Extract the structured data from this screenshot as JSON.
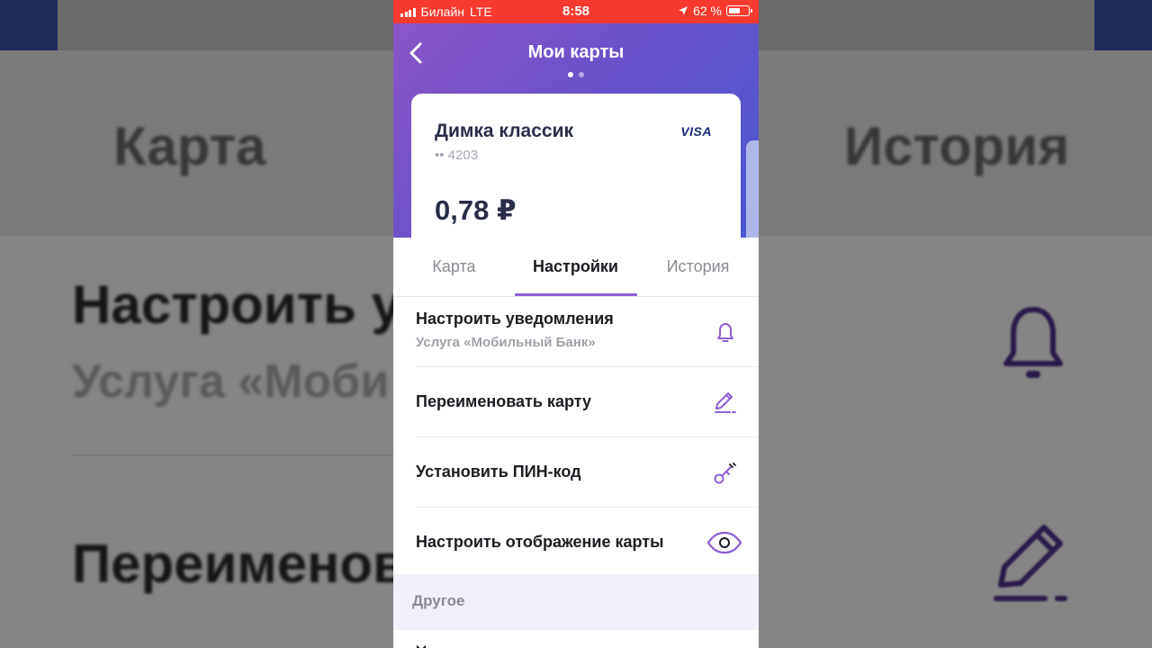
{
  "background": {
    "left_tab": "Карта",
    "right_tab": "История",
    "row1_title": "Настроить у",
    "row1_sub": "Услуга «Моби",
    "row2_title": "Переименов"
  },
  "status_bar": {
    "carrier": "Билайн",
    "network": "LTE",
    "time": "8:58",
    "battery": "62 %",
    "battery_level": 0.62
  },
  "header": {
    "title": "Мои карты"
  },
  "card": {
    "name": "Димка классик",
    "number": "•• 4203",
    "brand": "VISA",
    "balance": "0,78 ₽"
  },
  "tabs": [
    {
      "label": "Карта"
    },
    {
      "label": "Настройки"
    },
    {
      "label": "История"
    }
  ],
  "settings": [
    {
      "label": "Настроить уведомления",
      "sub": "Услуга «Мобильный Банк»",
      "icon": "bell-icon"
    },
    {
      "label": "Переименовать карту",
      "icon": "pencil-icon"
    },
    {
      "label": "Установить ПИН-код",
      "icon": "key-icon"
    },
    {
      "label": "Настроить отображение карты",
      "icon": "eye-icon"
    }
  ],
  "section_other": "Другое",
  "colors": {
    "accent": "#8e5fd3",
    "status_bar": "#f73a2e",
    "header_start": "#8a56c8",
    "header_end": "#4a57cf"
  }
}
